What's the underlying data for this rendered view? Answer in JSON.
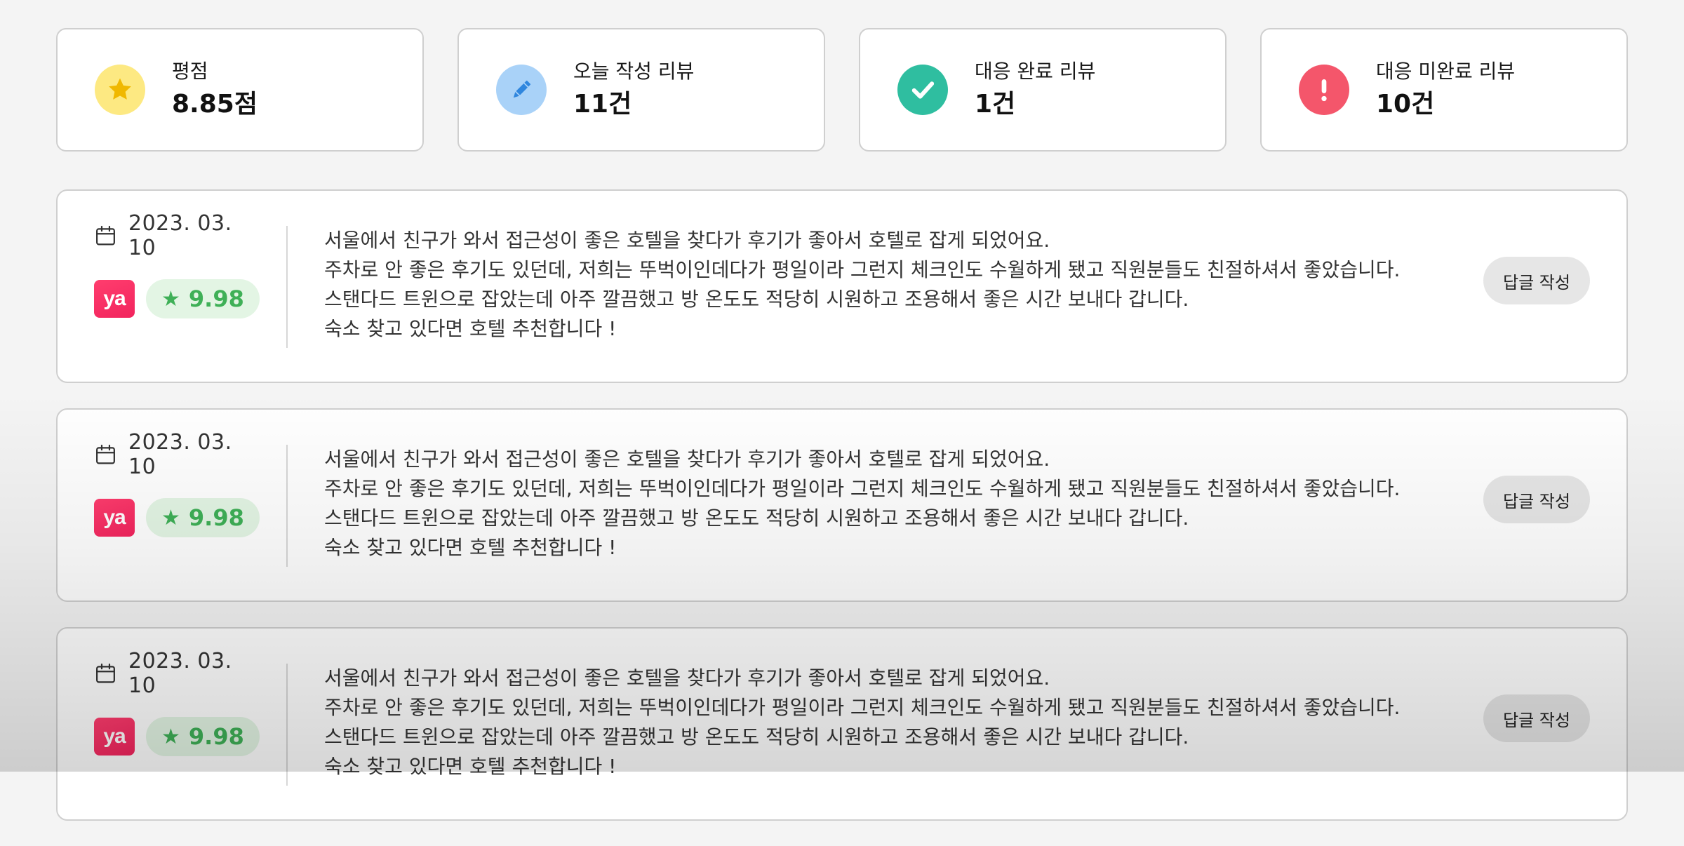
{
  "stats": [
    {
      "label": "평점",
      "value": "8.85점",
      "icon": "star-icon",
      "icon_bg": "#fde982",
      "icon_color": "#f0b800"
    },
    {
      "label": "오늘 작성 리뷰",
      "value": "11건",
      "icon": "pencil-icon",
      "icon_bg": "#a9d2f8",
      "icon_color": "#2f86de"
    },
    {
      "label": "대응 완료 리뷰",
      "value": "1건",
      "icon": "check-icon",
      "icon_bg": "#2fbea0",
      "icon_color": "#ffffff"
    },
    {
      "label": "대응 미완료 리뷰",
      "value": "10건",
      "icon": "exclamation-icon",
      "icon_bg": "#f4566b",
      "icon_color": "#ffffff"
    }
  ],
  "reviews": [
    {
      "date": "2023. 03. 10",
      "brand_logo_text": "ya",
      "score": "9.98",
      "lines": [
        "서울에서 친구가 와서 접근성이 좋은 호텔을 찾다가 후기가 좋아서 호텔로 잡게 되었어요.",
        "주차로 안 좋은 후기도 있던데, 저희는 뚜벅이인데다가 평일이라 그런지 체크인도 수월하게 됐고 직원분들도 친절하셔서 좋았습니다.",
        "스탠다드 트윈으로 잡았는데 아주 깔끔했고 방 온도도 적당히 시원하고 조용해서 좋은 시간 보내다 갑니다.",
        "숙소 찾고 있다면 호텔 추천합니다 !"
      ],
      "reply_label": "답글 작성"
    },
    {
      "date": "2023. 03. 10",
      "brand_logo_text": "ya",
      "score": "9.98",
      "lines": [
        "서울에서 친구가 와서 접근성이 좋은 호텔을 찾다가 후기가 좋아서 호텔로 잡게 되었어요.",
        "주차로 안 좋은 후기도 있던데, 저희는 뚜벅이인데다가 평일이라 그런지 체크인도 수월하게 됐고 직원분들도 친절하셔서 좋았습니다.",
        "스탠다드 트윈으로 잡았는데 아주 깔끔했고 방 온도도 적당히 시원하고 조용해서 좋은 시간 보내다 갑니다.",
        "숙소 찾고 있다면 호텔 추천합니다 !"
      ],
      "reply_label": "답글 작성"
    },
    {
      "date": "2023. 03. 10",
      "brand_logo_text": "ya",
      "score": "9.98",
      "lines": [
        "서울에서 친구가 와서 접근성이 좋은 호텔을 찾다가 후기가 좋아서 호텔로 잡게 되었어요.",
        "주차로 안 좋은 후기도 있던데, 저희는 뚜벅이인데다가 평일이라 그런지 체크인도 수월하게 됐고 직원분들도 친절하셔서 좋았습니다.",
        "스탠다드 트윈으로 잡았는데 아주 깔끔했고 방 온도도 적당히 시원하고 조용해서 좋은 시간 보내다 갑니다.",
        "숙소 찾고 있다면 호텔 추천합니다 !"
      ],
      "reply_label": "답글 작성"
    }
  ],
  "colors": {
    "score_text": "#3fb057",
    "score_bg": "#e3f5e4",
    "brand_pink": "#f2245d"
  }
}
